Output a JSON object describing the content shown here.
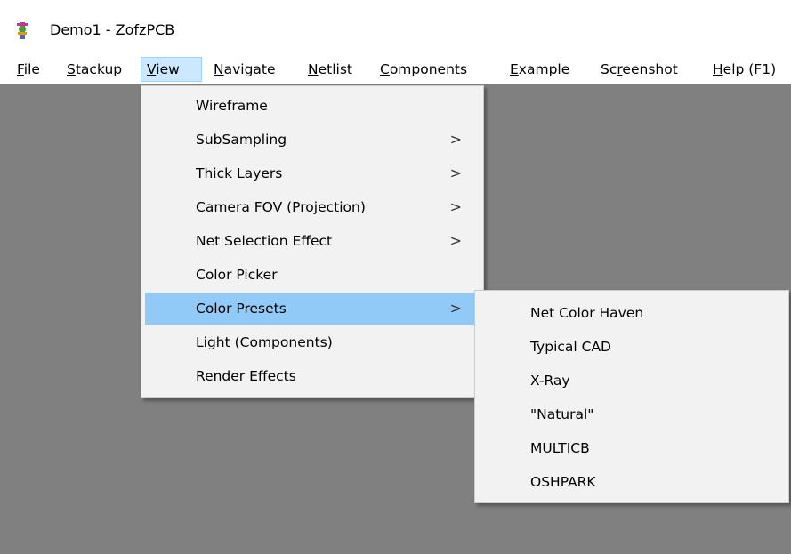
{
  "window": {
    "title": "Demo1 - ZofzPCB",
    "icon": "zofzpcb-app-icon"
  },
  "menubar": {
    "items": [
      {
        "label_mn": "F",
        "label_rest": "ile"
      },
      {
        "label_mn": "S",
        "label_rest": "tackup"
      },
      {
        "label_mn": "V",
        "label_rest": "iew"
      },
      {
        "label_mn": "N",
        "label_rest": "avigate"
      },
      {
        "label_mn": "N",
        "label_rest": "etlist"
      },
      {
        "label_mn": "C",
        "label_rest": "omponents"
      },
      {
        "label_mn": "E",
        "label_rest": "xample"
      },
      {
        "label_pre": "Sc",
        "label_mn": "r",
        "label_rest": "eenshot"
      },
      {
        "label_mn": "H",
        "label_rest": "elp (F1)"
      }
    ],
    "active_index": 2
  },
  "view_menu": {
    "items": [
      {
        "label": "Wireframe",
        "has_submenu": false
      },
      {
        "label": "SubSampling",
        "has_submenu": true
      },
      {
        "label": "Thick Layers",
        "has_submenu": true
      },
      {
        "label": "Camera FOV (Projection)",
        "has_submenu": true
      },
      {
        "label": "Net Selection Effect",
        "has_submenu": true
      },
      {
        "label": "Color Picker",
        "has_submenu": false
      },
      {
        "label": "Color Presets",
        "has_submenu": true,
        "highlighted": true
      },
      {
        "label": "Light (Components)",
        "has_submenu": false
      },
      {
        "label": "Render Effects",
        "has_submenu": false
      }
    ],
    "submenu_glyph": ">"
  },
  "color_presets_menu": {
    "items": [
      {
        "label": "Net Color Haven"
      },
      {
        "label": "Typical CAD"
      },
      {
        "label": "X-Ray"
      },
      {
        "label": "\"Natural\""
      },
      {
        "label": "MULTICB"
      },
      {
        "label": "OSHPARK"
      }
    ]
  },
  "colors": {
    "canvas": "#808080",
    "menu_background": "#f2f2f2",
    "highlight": "#91c9f7",
    "active_menubar": "#cce8ff"
  }
}
